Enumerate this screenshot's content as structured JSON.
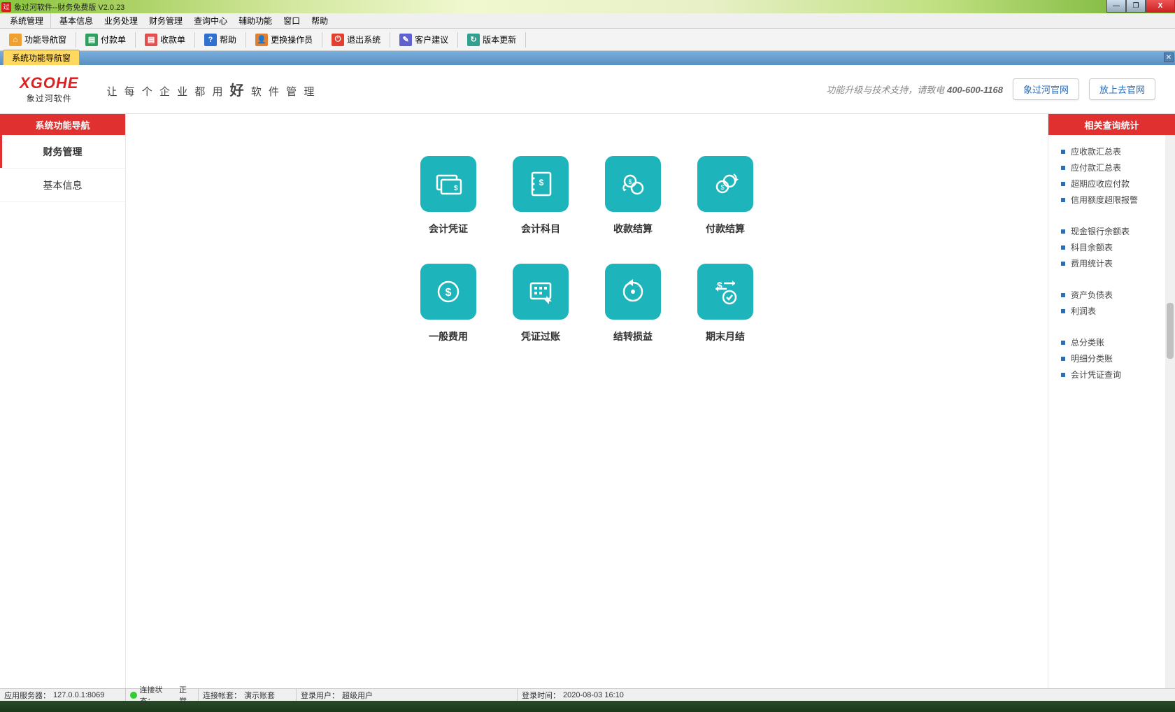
{
  "window": {
    "title": "象过河软件--财务免费版 V2.0.23"
  },
  "menubar": [
    "系统管理",
    "基本信息",
    "业务处理",
    "财务管理",
    "查询中心",
    "辅助功能",
    "窗口",
    "帮助"
  ],
  "toolbar": [
    {
      "icon": "home",
      "color": "#f0a030",
      "label": "功能导航窗"
    },
    {
      "icon": "doc",
      "color": "#30a060",
      "label": "付款单"
    },
    {
      "icon": "doc",
      "color": "#e05050",
      "label": "收款单"
    },
    {
      "icon": "help",
      "color": "#3070d0",
      "label": "帮助"
    },
    {
      "icon": "user",
      "color": "#e08030",
      "label": "更换操作员"
    },
    {
      "icon": "exit",
      "color": "#e04030",
      "label": "退出系统"
    },
    {
      "icon": "note",
      "color": "#6060d0",
      "label": "客户建议"
    },
    {
      "icon": "update",
      "color": "#30a090",
      "label": "版本更新"
    }
  ],
  "tab": {
    "active": "系统功能导航窗"
  },
  "brand": {
    "logo": "XGOHE",
    "logo_sub": "象过河软件",
    "slogan_pre": "让 每 个 企 业 都 用",
    "slogan_big": "好",
    "slogan_post": "软 件 管 理",
    "support": "功能升级与技术支持，请致电",
    "phone": "400-600-1168",
    "link1": "象过河官网",
    "link2": "放上去官网"
  },
  "left": {
    "header": "系统功能导航",
    "items": [
      "财务管理",
      "基本信息"
    ],
    "active_index": 0
  },
  "functions": [
    {
      "label": "会计凭证",
      "icon": "voucher"
    },
    {
      "label": "会计科目",
      "icon": "subject"
    },
    {
      "label": "收款结算",
      "icon": "receive"
    },
    {
      "label": "付款结算",
      "icon": "pay"
    },
    {
      "label": "一般费用",
      "icon": "expense"
    },
    {
      "label": "凭证过账",
      "icon": "post"
    },
    {
      "label": "结转损益",
      "icon": "carry"
    },
    {
      "label": "期末月结",
      "icon": "close"
    }
  ],
  "right": {
    "header": "相关查询统计",
    "groups": [
      [
        "应收款汇总表",
        "应付款汇总表",
        "超期应收应付款",
        "信用额度超限报警"
      ],
      [
        "现金银行余额表",
        "科目余额表",
        "费用统计表"
      ],
      [
        "资产负债表",
        "利润表"
      ],
      [
        "总分类账",
        "明细分类账",
        "会计凭证查询"
      ]
    ]
  },
  "status": {
    "server_label": "应用服务器：",
    "server": "127.0.0.1:8069",
    "conn_label": "连接状态：",
    "conn": "正常",
    "acct_label": "连接帐套：",
    "acct": "演示账套",
    "user_label": "登录用户：",
    "user": "超级用户",
    "time_label": "登录时间：",
    "time": "2020-08-03 16:10"
  }
}
